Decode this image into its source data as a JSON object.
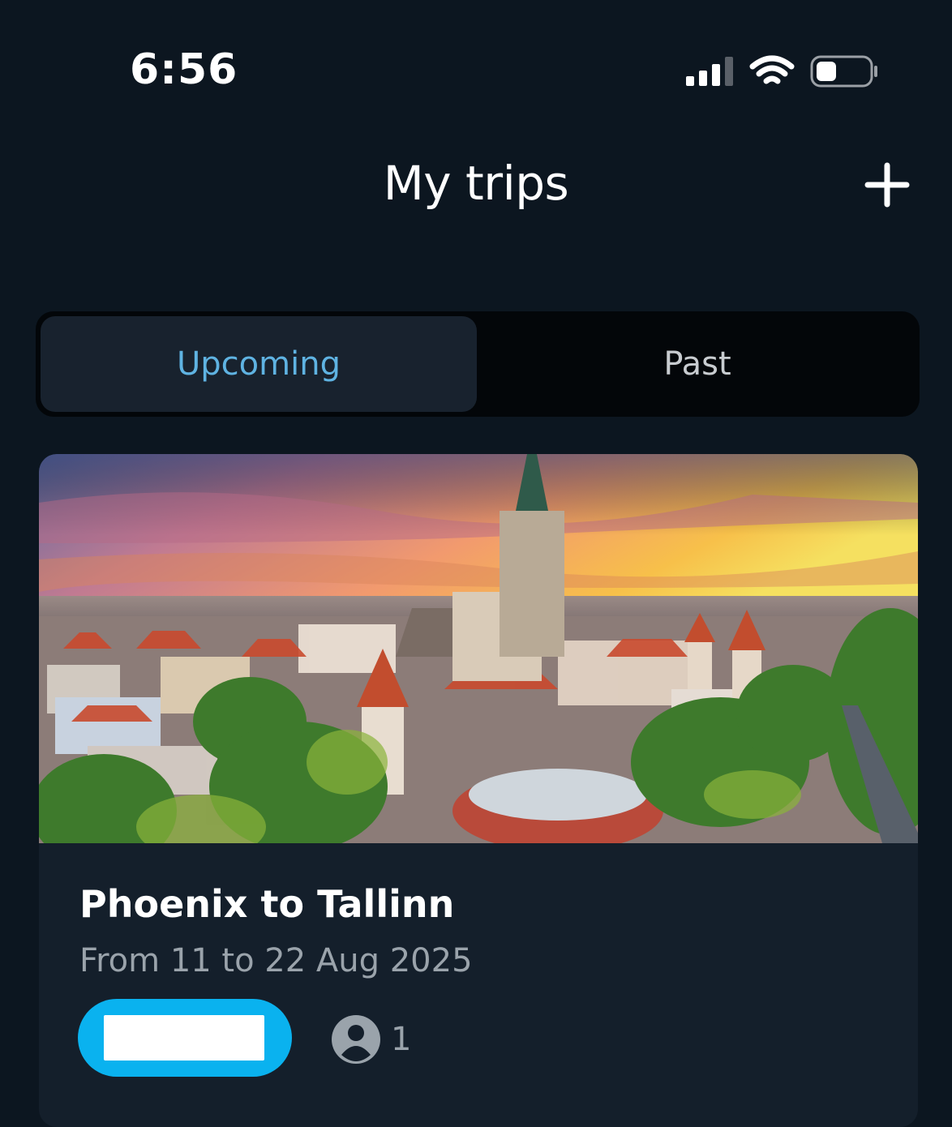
{
  "status_bar": {
    "time": "6:56",
    "icons": [
      "cellular-signal-icon",
      "wifi-icon",
      "battery-icon"
    ]
  },
  "header": {
    "title": "My trips",
    "add_icon": "plus-icon"
  },
  "tabs": [
    {
      "label": "Upcoming",
      "active": true
    },
    {
      "label": "Past",
      "active": false
    }
  ],
  "trips": [
    {
      "title": "Phoenix to Tallinn",
      "dates": "From 11 to 22 Aug 2025",
      "travellers_count": "1",
      "travellers_icon": "person-icon"
    }
  ],
  "colors": {
    "background": "#0c1620",
    "card": "#141f2b",
    "accent_tab": "#5fb3e2",
    "badge": "#0ab2ef"
  }
}
